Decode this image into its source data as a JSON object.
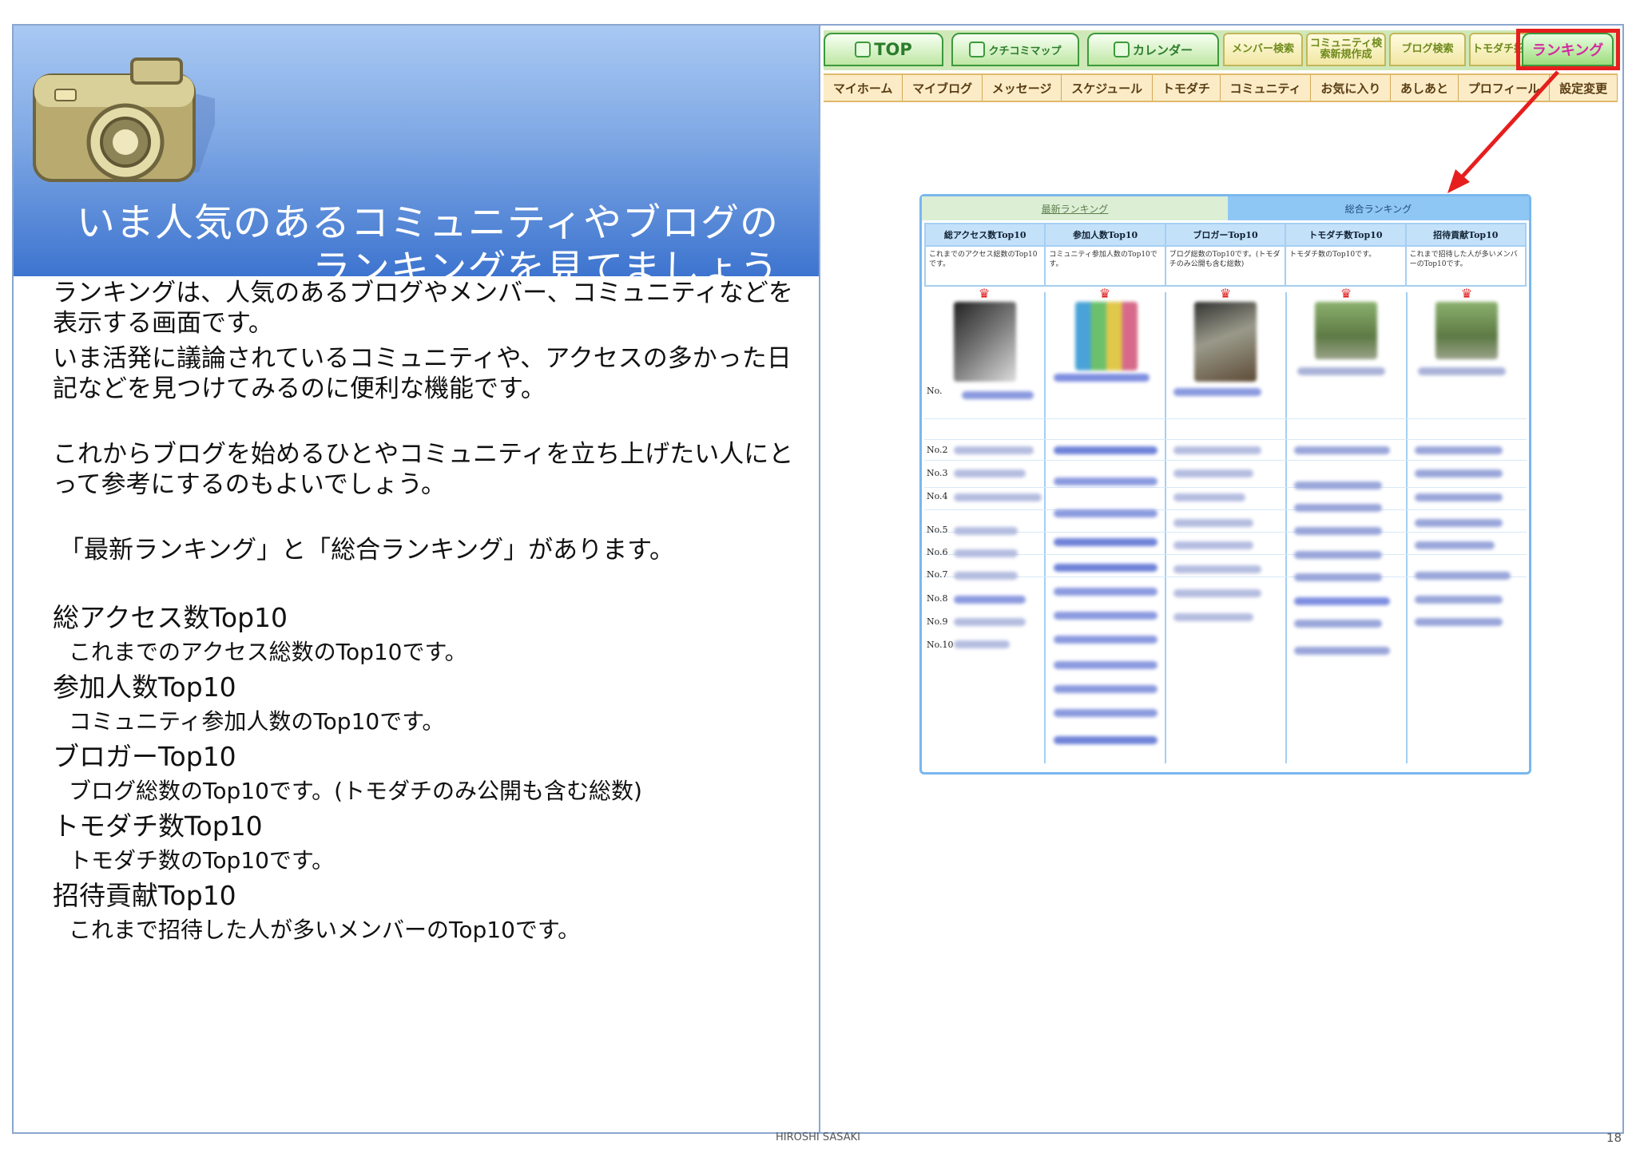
{
  "slide": {
    "title_line1": "いま人気のあるコミュニティやブログの",
    "title_line2": "ランキングを見てましょう",
    "paragraphs": [
      "ランキングは、人気のあるブログやメンバー、コミュニティなどを表示する画面です。",
      "いま活発に議論されているコミュニティや、アクセスの多かった日記などを見つけてみるのに便利な機能です。",
      "これからブログを始めるひとやコミュニティを立ち上げたい人にとって参考にするのもよいでしょう。",
      "「最新ランキング」と「総合ランキング」があります。"
    ],
    "items": [
      {
        "heading": "総アクセス数Top10",
        "desc": "これまでのアクセス総数のTop10です。"
      },
      {
        "heading": "参加人数Top10",
        "desc": "コミュニティ参加人数のTop10です。"
      },
      {
        "heading": "ブロガーTop10",
        "desc": "ブログ総数のTop10です。(トモダチのみ公開も含む総数)"
      },
      {
        "heading": "トモダチ数Top10",
        "desc": "トモダチ数のTop10です。"
      },
      {
        "heading": "招待貢献Top10",
        "desc": "これまで招待した人が多いメンバーのTop10です。"
      }
    ],
    "footer_author": "HIROSHI SASAKI",
    "page_number": "18"
  },
  "screenshot": {
    "top_tabs": [
      {
        "label": "TOP",
        "icon": "house-icon"
      },
      {
        "label": "クチコミマップ",
        "icon": "map-pin-icon"
      },
      {
        "label": "カレンダー",
        "icon": "calendar-icon"
      },
      {
        "label": "メンバー検索",
        "icon": "smile-icon"
      },
      {
        "label": "コミュニティ検索新規作成",
        "icon": "community-icon"
      },
      {
        "label": "ブログ検索",
        "icon": "pencil-icon"
      },
      {
        "label": "トモダチ招待",
        "icon": "invite-icon"
      },
      {
        "label": "ランキング",
        "icon": "ranking-icon"
      }
    ],
    "sub_nav": [
      "マイホーム",
      "マイブログ",
      "メッセージ",
      "スケジュール",
      "トモダチ",
      "コミュニティ",
      "お気に入り",
      "あしあと",
      "プロフィール",
      "設定変更"
    ],
    "ranking": {
      "tab_latest": "最新ランキング",
      "tab_overall": "総合ランキング",
      "columns": [
        {
          "header": "総アクセス数Top10",
          "desc": "これまでのアクセス総数のTop10です。"
        },
        {
          "header": "参加人数Top10",
          "desc": "コミュニティ参加人数のTop10です。"
        },
        {
          "header": "ブロガーTop10",
          "desc": "ブログ総数のTop10です。(トモダチのみ公開も含む総数)"
        },
        {
          "header": "トモダチ数Top10",
          "desc": "トモダチ数のTop10です。"
        },
        {
          "header": "招待貢献Top10",
          "desc": "これまで招待した人が多いメンバーのTop10です。"
        }
      ],
      "first_label": "No.",
      "row_labels": [
        "No.2",
        "No.3",
        "No.4",
        "No.5",
        "No.6",
        "No.7",
        "No.8",
        "No.9",
        "No.10"
      ]
    }
  }
}
